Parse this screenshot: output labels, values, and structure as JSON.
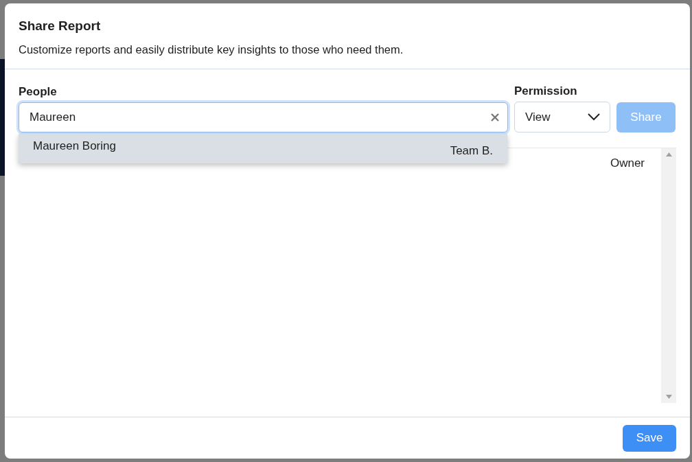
{
  "dialog": {
    "title": "Share Report",
    "subtitle": "Customize reports and easily distribute key insights to those who need them."
  },
  "people": {
    "label": "People",
    "value": "Maureen",
    "suggestions": [
      {
        "name": "Maureen Boring",
        "team": "Team B.",
        "selected": true
      }
    ]
  },
  "permission": {
    "label": "Permission",
    "value": "View"
  },
  "share_button": {
    "label": "Share",
    "disabled": true
  },
  "members": [
    {
      "role": "Owner"
    }
  ],
  "save_button": {
    "label": "Save"
  }
}
